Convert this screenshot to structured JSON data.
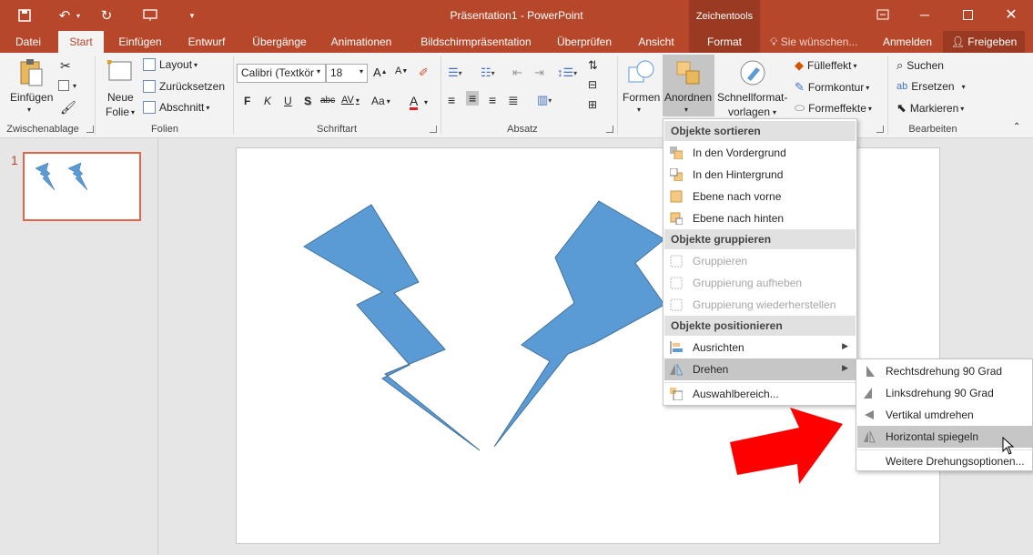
{
  "window": {
    "title": "Präsentation1 - PowerPoint",
    "context_group": "Zeichentools",
    "restore_icon": "restore-icon",
    "controls": [
      "minimize-icon",
      "maximize-icon",
      "close-icon"
    ]
  },
  "tabs": [
    {
      "label": "Datei",
      "state": "normal"
    },
    {
      "label": "Start",
      "state": "active"
    },
    {
      "label": "Einfügen",
      "state": "normal"
    },
    {
      "label": "Entwurf",
      "state": "normal"
    },
    {
      "label": "Übergänge",
      "state": "normal"
    },
    {
      "label": "Animationen",
      "state": "normal"
    },
    {
      "label": "Bildschirmpräsentation",
      "state": "normal"
    },
    {
      "label": "Überprüfen",
      "state": "normal"
    },
    {
      "label": "Ansicht",
      "state": "normal"
    },
    {
      "label": "Format",
      "state": "context"
    }
  ],
  "tell_me": "Sie wünschen...",
  "signin": "Anmelden",
  "share": "Freigeben",
  "ribbon": {
    "clipboard": {
      "paste": "Einfügen",
      "label": "Zwischenablage"
    },
    "slides": {
      "new_slide_1": "Neue",
      "new_slide_2": "Folie",
      "layout": "Layout",
      "reset": "Zurücksetzen",
      "section": "Abschnitt",
      "label": "Folien"
    },
    "font": {
      "name": "Calibri (Textkör",
      "size": "18",
      "bold": "F",
      "italic": "K",
      "underline": "U",
      "shadow": "S",
      "strike": "abc",
      "spacing": "AV",
      "case": "Aa",
      "color": "A",
      "label": "Schriftart"
    },
    "paragraph": {
      "label": "Absatz"
    },
    "drawing": {
      "shapes": "Formen",
      "arrange": "Anordnen",
      "quickstyles_1": "Schnellformat-",
      "quickstyles_2": "vorlagen",
      "fill": "Fülleffekt",
      "outline": "Formkontur",
      "effects": "Formeffekte"
    },
    "editing": {
      "find": "Suchen",
      "replace": "Ersetzen",
      "select": "Markieren",
      "label": "Bearbeiten"
    }
  },
  "slide_panel": {
    "number": "1"
  },
  "arrange_menu": {
    "sections": {
      "order": "Objekte sortieren",
      "group": "Objekte gruppieren",
      "position": "Objekte positionieren"
    },
    "items": {
      "bring_front": "In den Vordergrund",
      "send_back": "In den Hintergrund",
      "bring_forward": "Ebene nach vorne",
      "send_backward": "Ebene nach hinten",
      "group": "Gruppieren",
      "ungroup": "Gruppierung aufheben",
      "regroup": "Gruppierung wiederherstellen",
      "align": "Ausrichten",
      "rotate": "Drehen",
      "selection_pane": "Auswahlbereich..."
    }
  },
  "rotate_menu": {
    "items": {
      "rotate_right": "Rechtsdrehung 90 Grad",
      "rotate_left": "Linksdrehung 90 Grad",
      "flip_vertical": "Vertikal umdrehen",
      "flip_horizontal": "Horizontal spiegeln",
      "more": "Weitere Drehungsoptionen..."
    }
  },
  "colors": {
    "accent": "#b7472a",
    "shape_fill": "#5b9bd5",
    "arrow": "#ff0000"
  }
}
